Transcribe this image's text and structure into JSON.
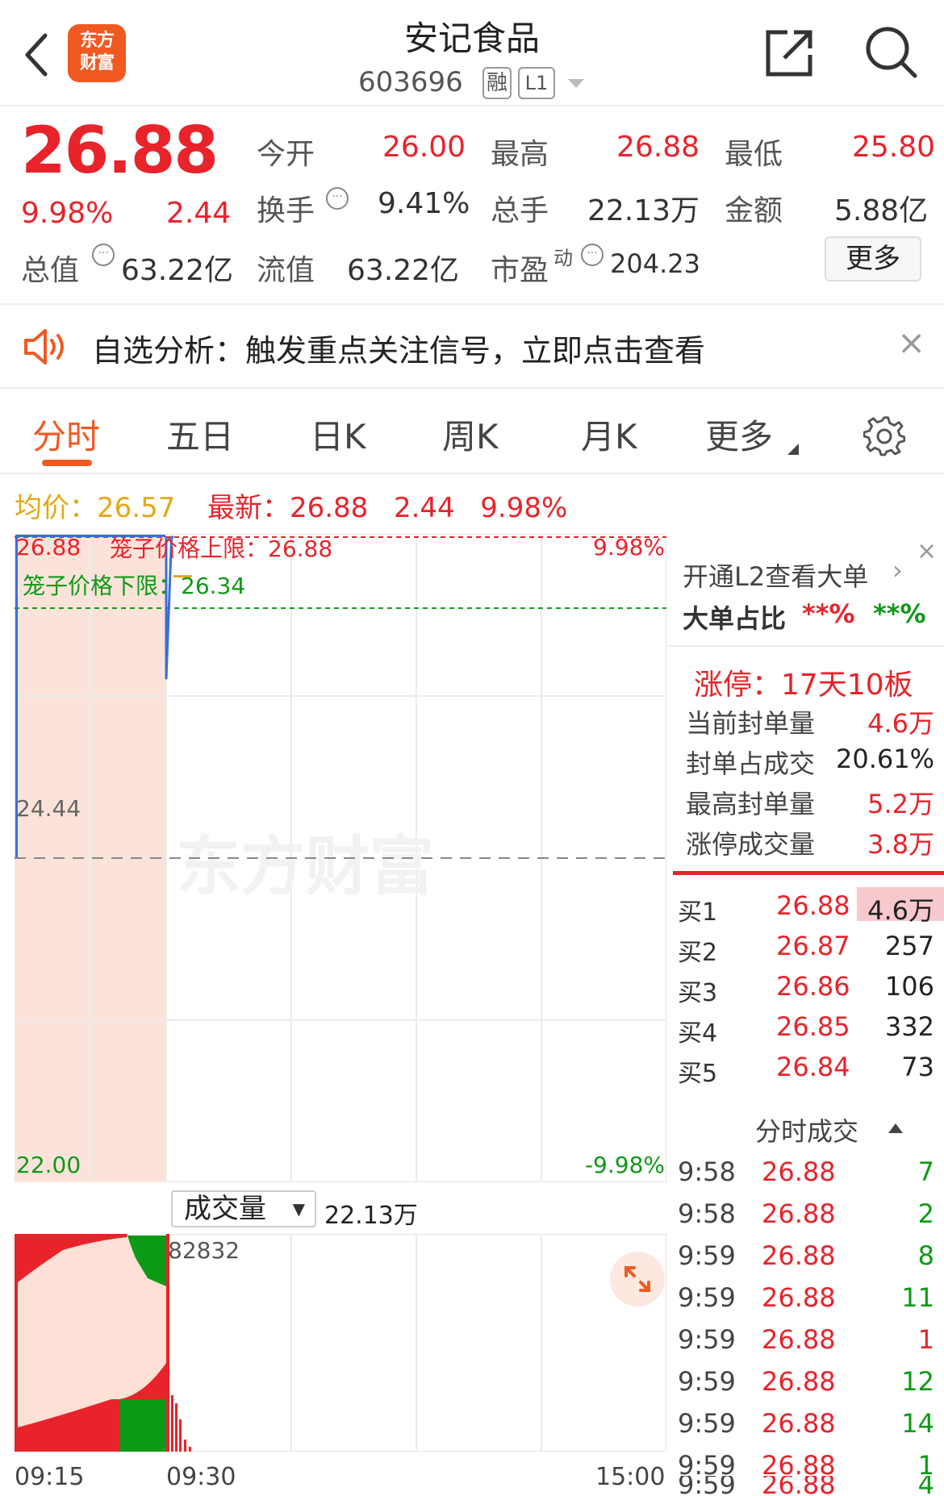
{
  "header": {
    "logo_line1": "东方",
    "logo_line2": "财富",
    "title": "安记食品",
    "code": "603696",
    "tag_rong": "融",
    "tag_l1": "L1"
  },
  "quote": {
    "price": "26.88",
    "change_pct": "9.98%",
    "change_amt": "2.44",
    "open_label": "今开",
    "open_value": "26.00",
    "high_label": "最高",
    "high_value": "26.88",
    "low_label": "最低",
    "low_value": "25.80",
    "turnover_label": "换手",
    "turnover_value": "9.41%",
    "volume_label": "总手",
    "volume_value": "22.13万",
    "amount_label": "金额",
    "amount_value": "5.88亿",
    "mktcap_label": "总值",
    "mktcap_value": "63.22亿",
    "float_label": "流值",
    "float_value": "63.22亿",
    "pe_label": "市盈",
    "pe_sup": "动",
    "pe_value": "204.23",
    "more_label": "更多"
  },
  "notice": {
    "text": "自选分析：触发重点关注信号，立即点击查看",
    "close": "×"
  },
  "tabs": [
    "分时",
    "五日",
    "日K",
    "周K",
    "月K",
    "更多"
  ],
  "avgline": {
    "avg_label": "均价：",
    "avg_value": "26.57",
    "last_label": "最新：",
    "last_value": "26.88",
    "last_amt": "2.44",
    "last_pct": "9.98%"
  },
  "chart_data": [
    {
      "type": "line",
      "y_top_label": "26.88",
      "y_mid_label": "24.44",
      "y_bottom_label": "22.00",
      "pct_top": "9.98%",
      "pct_bottom": "-9.98%",
      "upper_limit_label": "笼子价格上限：26.88",
      "lower_limit_label": "笼子价格下限：26.34",
      "watermark": "东方财富",
      "ylim": [
        22.0,
        26.88
      ],
      "upper_limit": 26.88,
      "lower_limit": 26.34,
      "pre_close": 24.44,
      "price_series": {
        "x": [
          "09:30",
          "09:30",
          "09:31",
          "09:32"
        ],
        "y": [
          26.88,
          25.8,
          26.88,
          26.88
        ]
      },
      "avg_series": {
        "x": [
          "09:31",
          "09:40"
        ],
        "y": [
          26.57,
          26.57
        ]
      }
    },
    {
      "type": "bar",
      "selector_label": "成交量",
      "total": "22.13万",
      "max_label": "82832",
      "x_start": "09:15",
      "x_mid": "09:30",
      "x_end": "15:00"
    }
  ],
  "rpanel": {
    "l2_link": "开通L2查看大单",
    "big_order_label": "大单占比",
    "big_order_buy": "**%",
    "big_order_sell": "**%",
    "limit_title": "涨停：17天10板",
    "seal_label": "当前封单量",
    "seal_value": "4.6万",
    "seal_ratio_label": "封单占成交",
    "seal_ratio_value": "20.61%",
    "max_seal_label": "最高封单量",
    "max_seal_value": "5.2万",
    "limit_vol_label": "涨停成交量",
    "limit_vol_value": "3.8万",
    "bids": [
      {
        "label": "买1",
        "price": "26.88",
        "vol": "4.6万"
      },
      {
        "label": "买2",
        "price": "26.87",
        "vol": "257"
      },
      {
        "label": "买3",
        "price": "26.86",
        "vol": "106"
      },
      {
        "label": "买4",
        "price": "26.85",
        "vol": "332"
      },
      {
        "label": "买5",
        "price": "26.84",
        "vol": "73"
      }
    ],
    "trades_title": "分时成交",
    "trades": [
      {
        "time": "9:58",
        "price": "26.88",
        "vol": "7"
      },
      {
        "time": "9:58",
        "price": "26.88",
        "vol": "2"
      },
      {
        "time": "9:59",
        "price": "26.88",
        "vol": "8"
      },
      {
        "time": "9:59",
        "price": "26.88",
        "vol": "11"
      },
      {
        "time": "9:59",
        "price": "26.88",
        "vol": "1"
      },
      {
        "time": "9:59",
        "price": "26.88",
        "vol": "12"
      },
      {
        "time": "9:59",
        "price": "26.88",
        "vol": "14"
      },
      {
        "time": "9:59",
        "price": "26.88",
        "vol": "1"
      },
      {
        "time": "9:59",
        "price": "26.88",
        "vol": "4"
      }
    ]
  },
  "colors": {
    "up": "#e8232a",
    "down": "#0d9a16",
    "avg": "#e3a817",
    "accent": "#f05a22",
    "price_line": "#3a6fd8"
  }
}
